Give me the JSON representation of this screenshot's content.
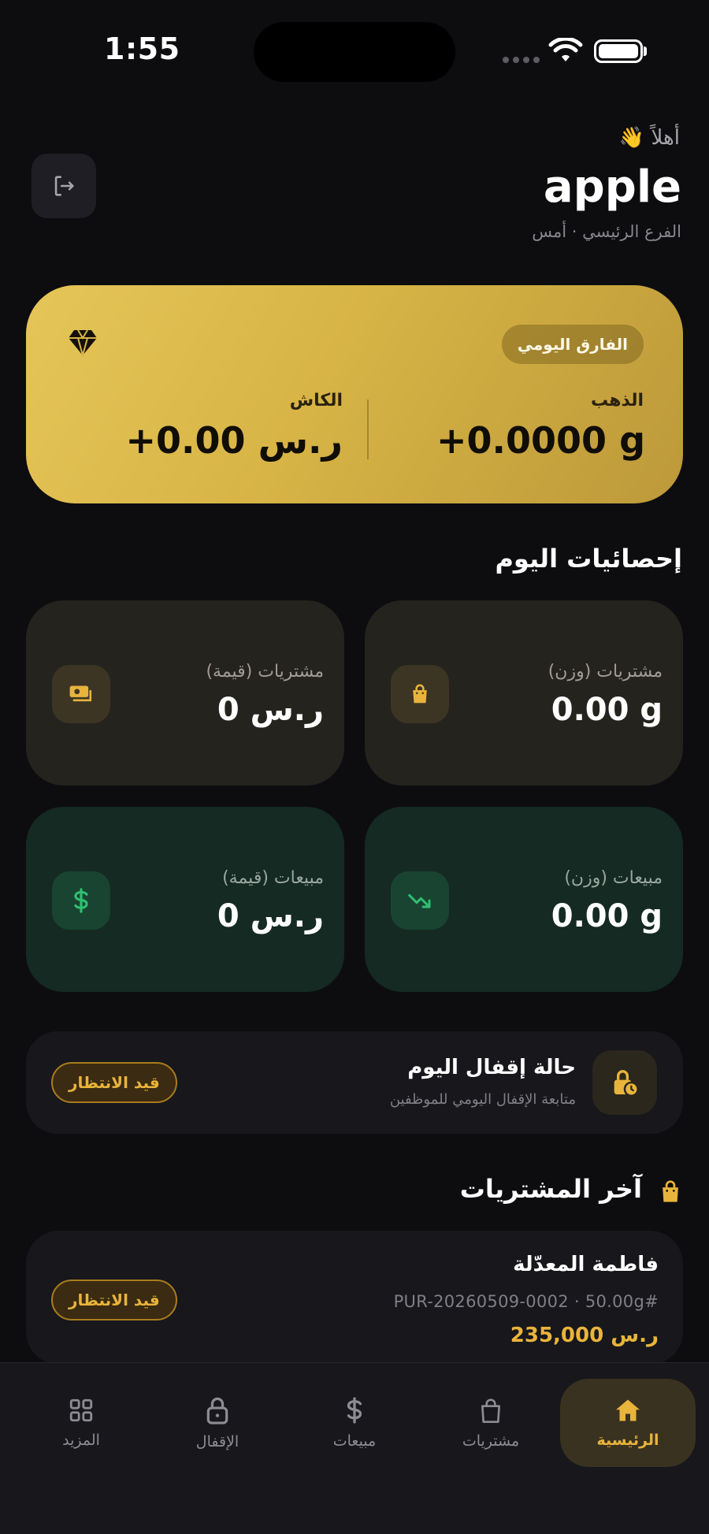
{
  "status_bar": {
    "time": "1:55"
  },
  "header": {
    "greeting": "أهلاً 👋",
    "title": "apple",
    "subtitle": "الفرع الرئيسي · أمس",
    "logout_icon": "logout-icon"
  },
  "daily_card": {
    "badge": "الفارق اليومي",
    "gold_label": "الذهب",
    "gold_value": "+0.0000 g",
    "cash_label": "الكاش",
    "cash_value": "+0.00 ر.س",
    "gradient_colors": [
      "#e6c558",
      "#bd993a"
    ]
  },
  "stats": {
    "title": "إحصائيات اليوم",
    "cards": [
      {
        "label": "مشتريات (وزن)",
        "value": "0.00 g",
        "icon": "shopping-bag-icon"
      },
      {
        "label": "مشتريات (قيمة)",
        "value": "0 ر.س",
        "icon": "cash-icon"
      },
      {
        "label": "مبيعات (وزن)",
        "value": "0.00 g",
        "icon": "trend-down-icon"
      },
      {
        "label": "مبيعات (قيمة)",
        "value": "0 ر.س",
        "icon": "dollar-icon"
      }
    ]
  },
  "closing": {
    "title": "حالة إقفال اليوم",
    "subtitle": "متابعة الإقفال اليومي للموظفين",
    "status": "قيد الانتظار",
    "icon": "lock-clock-icon"
  },
  "last_purchases": {
    "title": "آخر المشتريات",
    "items": [
      {
        "name": "فاطمة المعدّلة",
        "ref": "PUR-20260509-0002 · 50.00g#",
        "amount": "235,000 ر.س",
        "status": "قيد الانتظار"
      }
    ]
  },
  "nav": {
    "items": [
      {
        "label": "الرئيسية",
        "icon": "home-icon",
        "active": true
      },
      {
        "label": "مشتريات",
        "icon": "shopping-bag-icon",
        "active": false
      },
      {
        "label": "مبيعات",
        "icon": "dollar-icon",
        "active": false
      },
      {
        "label": "الإقفال",
        "icon": "lock-icon",
        "active": false
      },
      {
        "label": "المزيد",
        "icon": "grid-icon",
        "active": false
      }
    ]
  },
  "colors": {
    "accent": "#e9b43b",
    "background": "#0d0d10",
    "purchase_card": "#25231e",
    "sale_card": "#142a22",
    "sale_icon": "#2fbf71"
  }
}
